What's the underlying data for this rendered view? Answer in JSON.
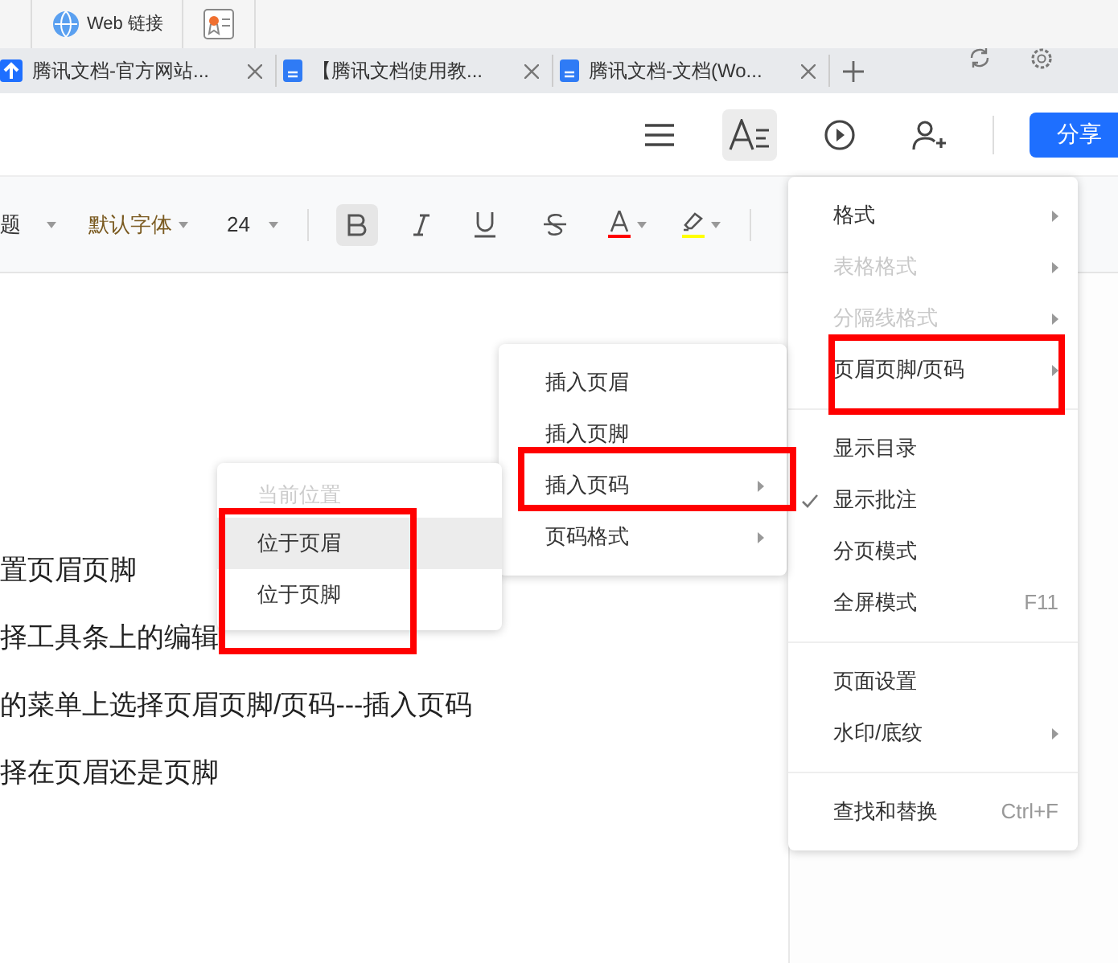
{
  "bookmark_bar": {
    "label": "Web 链接"
  },
  "tabs": [
    {
      "title": "腾讯文档-官方网站...",
      "kind": "site"
    },
    {
      "title": "【腾讯文档使用教...",
      "kind": "doc"
    },
    {
      "title": "腾讯文档-文档(Wo...",
      "kind": "doc"
    }
  ],
  "toolbar": {
    "tools": [
      {
        "kind": "list",
        "active": false
      },
      {
        "kind": "text-format",
        "active": true
      },
      {
        "kind": "play",
        "active": false
      },
      {
        "kind": "add-user",
        "active": false
      }
    ],
    "share_button": "分享"
  },
  "format_bar": {
    "style": "题",
    "font": "默认字体",
    "size": "24",
    "bold": true
  },
  "document": {
    "lines": [
      "置页眉页脚",
      "择工具条上的编辑",
      "的菜单上选择页眉页脚/页码---插入页码",
      "择在页眉还是页脚"
    ]
  },
  "menu": {
    "items": [
      {
        "kind": "item",
        "label": "格式",
        "disabled": false,
        "submenu": true,
        "checked": false
      },
      {
        "kind": "item",
        "label": "表格格式",
        "disabled": true,
        "submenu": true,
        "checked": false
      },
      {
        "kind": "item",
        "label": "分隔线格式",
        "disabled": true,
        "submenu": true,
        "checked": false
      },
      {
        "kind": "item",
        "label": "页眉页脚/页码",
        "disabled": false,
        "submenu": true,
        "checked": false
      },
      {
        "kind": "divider"
      },
      {
        "kind": "item",
        "label": "显示目录",
        "disabled": false,
        "submenu": false,
        "checked": false
      },
      {
        "kind": "item",
        "label": "显示批注",
        "disabled": false,
        "submenu": false,
        "checked": true
      },
      {
        "kind": "item",
        "label": "分页模式",
        "disabled": false,
        "submenu": false,
        "checked": false
      },
      {
        "kind": "item",
        "label": "全屏模式",
        "disabled": false,
        "submenu": false,
        "checked": false,
        "shortcut": "F11"
      },
      {
        "kind": "divider"
      },
      {
        "kind": "item",
        "label": "页面设置",
        "disabled": false,
        "submenu": false,
        "checked": false
      },
      {
        "kind": "item",
        "label": "水印/底纹",
        "disabled": false,
        "submenu": true,
        "checked": false
      },
      {
        "kind": "divider"
      },
      {
        "kind": "item",
        "label": "查找和替换",
        "disabled": false,
        "submenu": false,
        "checked": false,
        "shortcut": "Ctrl+F"
      }
    ]
  },
  "submenu": {
    "items": [
      {
        "label": "插入页眉",
        "submenu": false
      },
      {
        "label": "插入页脚",
        "submenu": false
      },
      {
        "label": "插入页码",
        "submenu": true
      },
      {
        "label": "页码格式",
        "submenu": true
      }
    ]
  },
  "position_menu": {
    "header": "当前位置",
    "items": [
      {
        "label": "位于页眉",
        "selected": true
      },
      {
        "label": "位于页脚",
        "selected": false
      }
    ]
  }
}
